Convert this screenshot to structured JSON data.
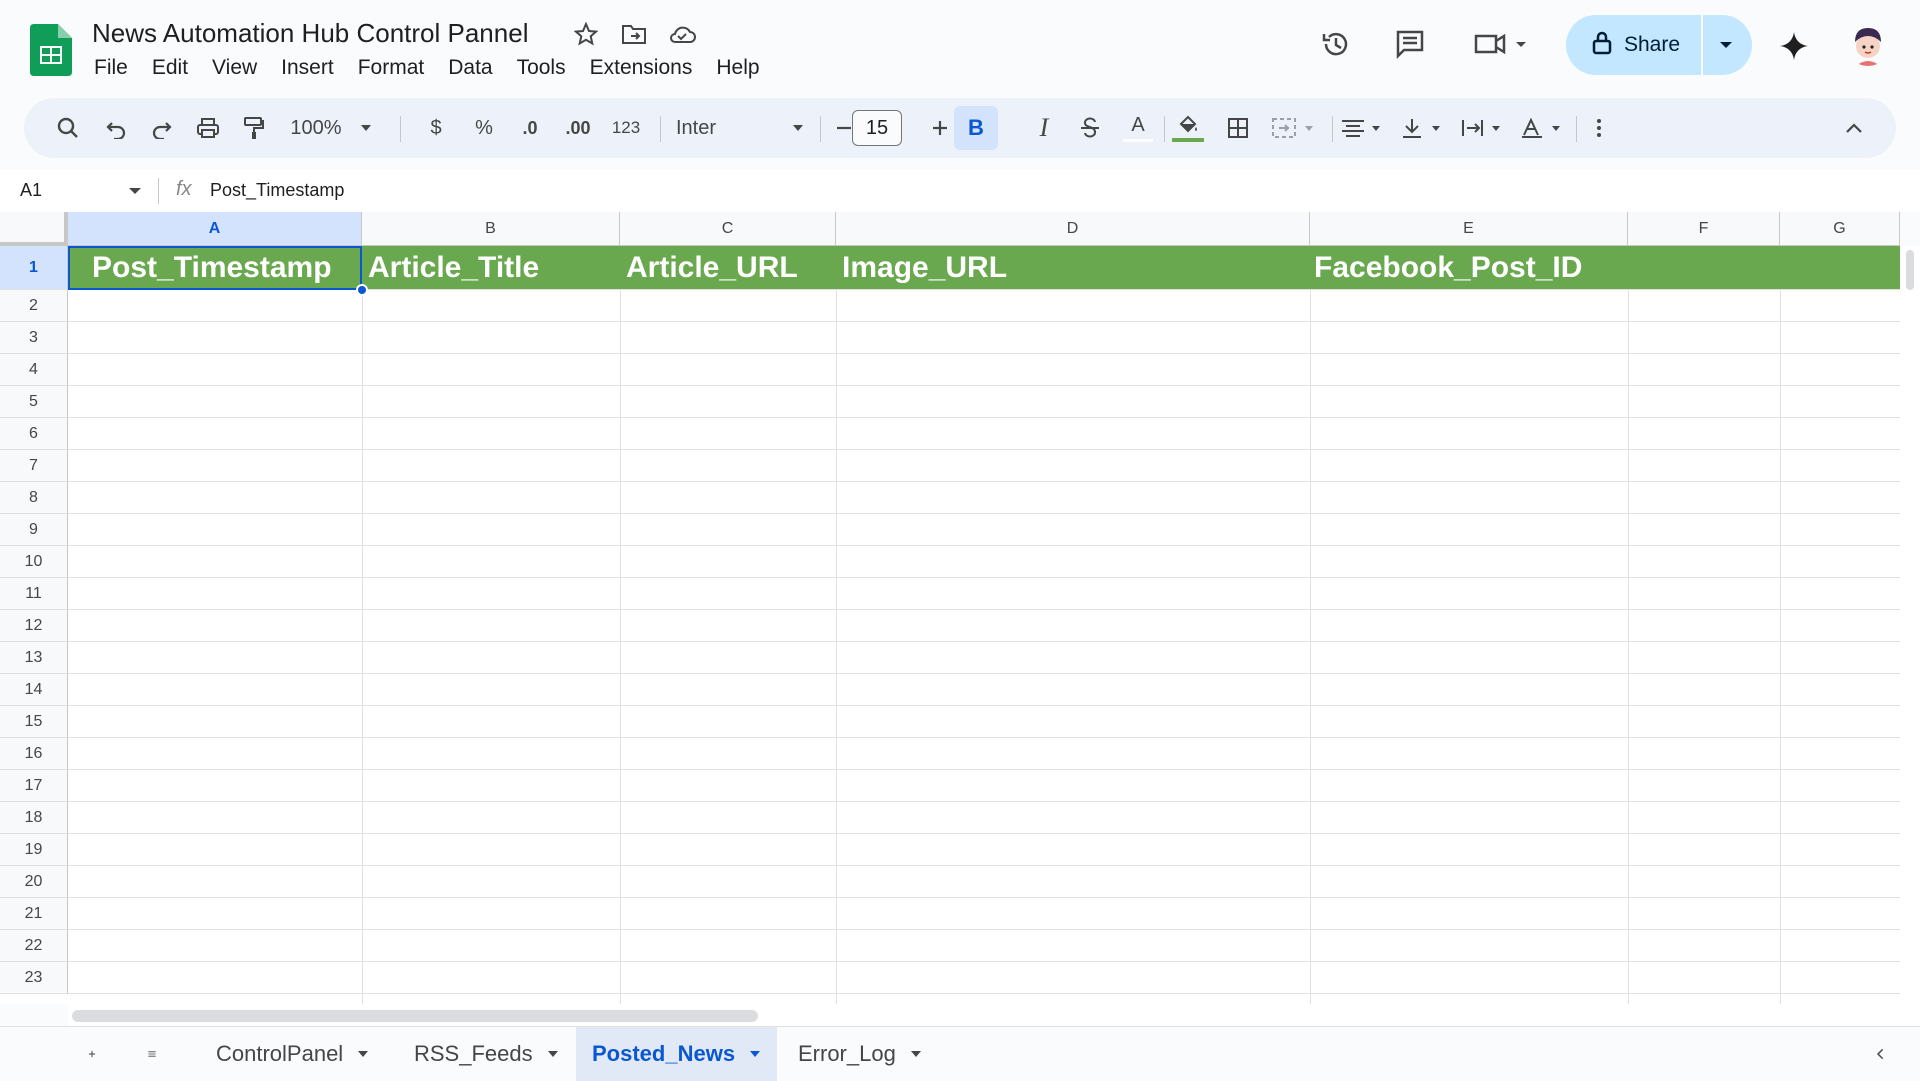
{
  "app": {
    "title": "News Automation Hub Control Pannel"
  },
  "menu": [
    "File",
    "Edit",
    "View",
    "Insert",
    "Format",
    "Data",
    "Tools",
    "Extensions",
    "Help"
  ],
  "share": {
    "label": "Share"
  },
  "toolbar": {
    "zoom": "100%",
    "currency": "$",
    "percent": "%",
    "dec_decrease": ".0",
    "dec_increase": ".00",
    "number_format": "123",
    "font": "Inter",
    "font_size": "15",
    "bold": "B",
    "italic": "I",
    "text_color": "A"
  },
  "formula_bar": {
    "cell_ref": "A1",
    "fx": "fx",
    "content": "Post_Timestamp"
  },
  "columns": [
    "A",
    "B",
    "C",
    "D",
    "E",
    "F",
    "G"
  ],
  "rows": [
    "1",
    "2",
    "3",
    "4",
    "5",
    "6",
    "7",
    "8",
    "9",
    "10",
    "11",
    "12",
    "13",
    "14",
    "15",
    "16",
    "17",
    "18",
    "19",
    "20",
    "21",
    "22",
    "23"
  ],
  "header_cells": [
    "Post_Timestamp",
    "Article_Title",
    "Article_URL",
    "Image_URL",
    "Facebook_Post_ID"
  ],
  "sheets": [
    {
      "name": "ControlPanel",
      "active": false
    },
    {
      "name": "RSS_Feeds",
      "active": false
    },
    {
      "name": "Posted_News",
      "active": true
    },
    {
      "name": "Error_Log",
      "active": false
    }
  ],
  "colors": {
    "header_fill": "#6aa84f",
    "accent": "#0b57d0",
    "share_bg": "#c2e7ff"
  }
}
